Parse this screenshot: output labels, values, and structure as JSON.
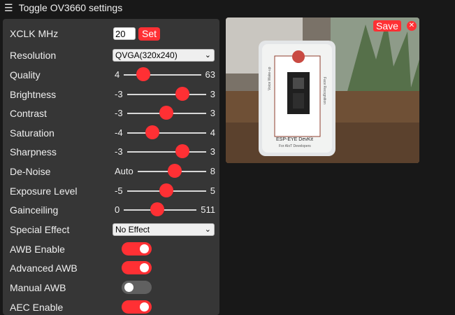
{
  "header": {
    "menu_icon": "hamburger-icon",
    "title": "Toggle OV3660 settings"
  },
  "settings": {
    "xclk": {
      "label": "XCLK MHz",
      "value": "20",
      "button": "Set"
    },
    "resolution": {
      "label": "Resolution",
      "selected": "QVGA(320x240)"
    },
    "quality": {
      "label": "Quality",
      "min": "4",
      "max": "63",
      "level": 0.2
    },
    "brightness": {
      "label": "Brightness",
      "min": "-3",
      "max": "3",
      "level": 0.75
    },
    "contrast": {
      "label": "Contrast",
      "min": "-3",
      "max": "3",
      "level": 0.5
    },
    "saturation": {
      "label": "Saturation",
      "min": "-4",
      "max": "4",
      "level": 0.28
    },
    "sharpness": {
      "label": "Sharpness",
      "min": "-3",
      "max": "3",
      "level": 0.75
    },
    "denoise": {
      "label": "De-Noise",
      "min": "Auto",
      "max": "8",
      "level": 0.55
    },
    "exposure_level": {
      "label": "Exposure Level",
      "min": "-5",
      "max": "5",
      "level": 0.5
    },
    "gainceiling": {
      "label": "Gainceiling",
      "min": "0",
      "max": "511",
      "level": 0.45
    },
    "special_effect": {
      "label": "Special Effect",
      "selected": "No Effect"
    },
    "awb_enable": {
      "label": "AWB Enable",
      "on": true
    },
    "advanced_awb": {
      "label": "Advanced AWB",
      "on": true
    },
    "manual_awb": {
      "label": "Manual AWB",
      "on": false
    },
    "aec_enable": {
      "label": "AEC Enable",
      "on": true
    }
  },
  "preview": {
    "save_label": "Save",
    "close_icon": "close-icon",
    "device_texts": [
      "ESP-EYE DevKit",
      "Voice Wake-up",
      "Face Recognition",
      "For AIoT Developers"
    ]
  },
  "colors": {
    "accent": "#ff3034",
    "panel": "#363636",
    "background": "#181818"
  }
}
